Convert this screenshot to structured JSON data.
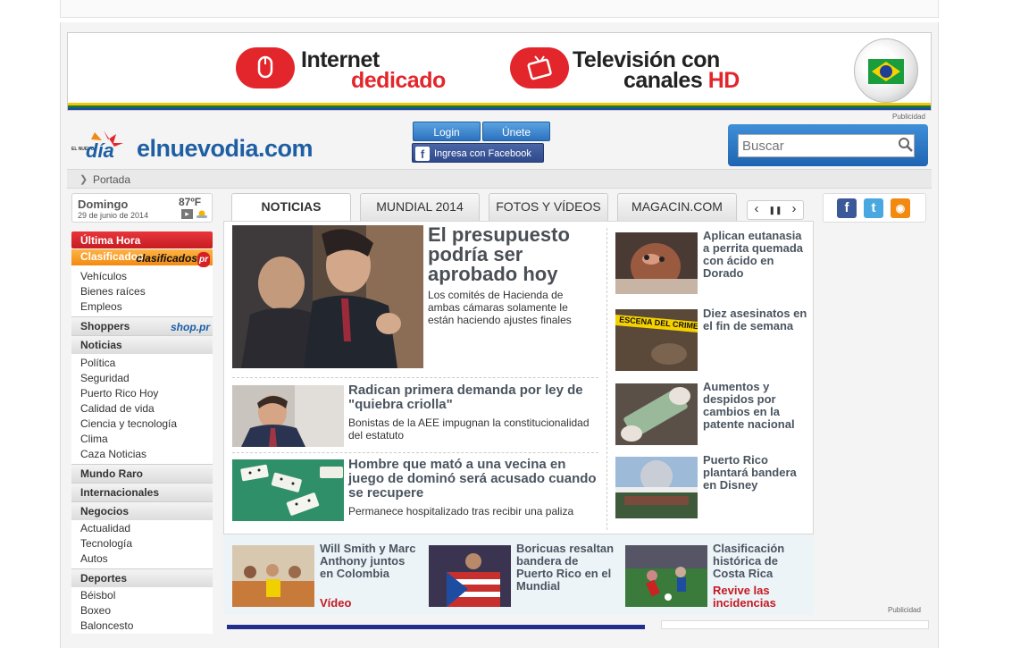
{
  "banner": {
    "ad1_line1": "Internet",
    "ad1_line2": "dedicado",
    "ad2_line1": "Televisión con",
    "ad2_line2": "canales",
    "ad2_hd": "HD",
    "publicidad": "Publicidad"
  },
  "header": {
    "logo_small": "EL NUEVO",
    "logo_word": "día",
    "site_name": "elnuevodia.com",
    "login": "Login",
    "join": "Únete",
    "facebook": "Ingresa con Facebook",
    "search_placeholder": "Buscar"
  },
  "breadcrumb": {
    "label": "Portada"
  },
  "date": {
    "day": "Domingo",
    "full": "29 de junio de 2014",
    "temp": "87ºF"
  },
  "sidebar": {
    "ultima_hora": "Última Hora",
    "clasificados": "Clasificados",
    "clasificados_logo": "clasificados",
    "clasificados_logo_badge": "pr",
    "clasificados_items": [
      "Vehículos",
      "Bienes raíces",
      "Empleos"
    ],
    "shoppers": "Shoppers",
    "shoppers_logo": "shop.pr",
    "noticias": "Noticias",
    "noticias_items": [
      "Política",
      "Seguridad",
      "Puerto Rico Hoy",
      "Calidad de vida",
      "Ciencia y tecnología",
      "Clima",
      "Caza Noticias"
    ],
    "mundo_raro": "Mundo Raro",
    "internacionales": "Internacionales",
    "negocios": "Negocios",
    "negocios_items": [
      "Actualidad",
      "Tecnología",
      "Autos"
    ],
    "deportes": "Deportes",
    "deportes_items": [
      "Béisbol",
      "Boxeo",
      "Baloncesto"
    ]
  },
  "tabs": [
    "NOTICIAS",
    "MUNDIAL 2014",
    "FOTOS Y VÍDEOS",
    "MAGACIN.COM"
  ],
  "carousel": {
    "prev": "‹",
    "pause": "❚❚",
    "next": "›"
  },
  "social": {
    "fb": "f",
    "tw": "t",
    "rss": "◉"
  },
  "main": {
    "lead_title": "El presupuesto podría ser aprobado hoy",
    "lead_sub": "Los comités de Hacienda de ambas cámaras solamente le están haciendo ajustes finales",
    "story2_title": "Radican primera demanda por ley de \"quiebra criolla\"",
    "story2_sub": "Bonistas de la AEE impugnan la constitucionalidad del estatuto",
    "story3_title": "Hombre que mató a una vecina en juego de dominó será acusado cuando se recupere",
    "story3_sub": "Permanece hospitalizado tras recibir una paliza",
    "side1": "Aplican eutanasia a perrita quemada con ácido en Dorado",
    "side2": "Diez asesinatos en el fin de semana",
    "side2_tape": "ESCENA DEL CRIMEN",
    "side3": "Aumentos y despidos por cambios en la patente nacional",
    "side4": "Puerto Rico plantará bandera en Disney"
  },
  "bottom": {
    "b1_title": "Will Smith y Marc Anthony juntos en Colombia",
    "b1_tag": "Vídeo",
    "b2_title": "Boricuas resaltan bandera de Puerto Rico en el Mundial",
    "b3_title": "Clasificación histórica de Costa Rica",
    "b3_tag": "Revive las incidencias",
    "publicidad": "Publicidad"
  },
  "colors": {
    "brand_blue": "#1e5fa3",
    "red": "#c41921",
    "orange": "#f28a12"
  }
}
